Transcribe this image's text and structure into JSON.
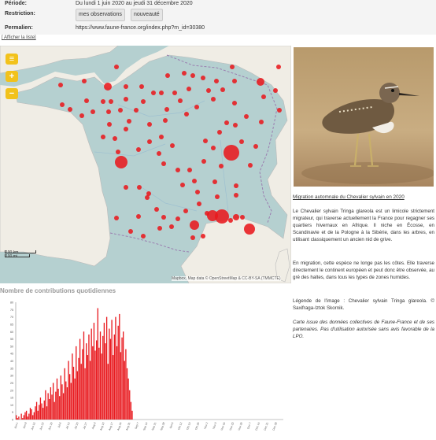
{
  "meta": {
    "period_label": "Période:",
    "period_value": "Du lundi 1 juin 2020 au jeudi 31 décembre 2020",
    "restriction_label": "Restriction:",
    "button_mine": "mes observations",
    "button_new": "nouveauté",
    "permalink_label": "Permalien:",
    "permalink_value": "https://www.faune-france.org/index.php?m_id=30380"
  },
  "list_toggle": "[ Afficher la liste]",
  "map": {
    "controls": [
      "layers-icon",
      "plus-icon",
      "minus-icon"
    ],
    "scale_km": "100 km",
    "scale_mi": "100 mi",
    "attribution": "Mapbox, Map data © OpenStreetMap & CC-BY-SA (TMMCTE)",
    "dot_color": "#e8191e"
  },
  "description": {
    "title": "Migration automnale du Chevalier sylvain en 2020",
    "para1": "Le Chevalier sylvain Tringa glareola est un limicole strictement migrateur, qui traverse actuellement la France pour regagner ses quartiers hivernaux en Afrique. Il niche en Écosse, en Scandinavie et de la Pologne à la Sibérie, dans les arbres, en utilisant classiquement un ancien nid de grive.",
    "para2": "En migration, cette espèce ne longe pas les côtes. Elle traverse directement le continent européen et peut donc être observée, au gré des haltes, dans tous les types de zones humides.",
    "legend": "Légende de l'image : Chevalier sylvain Tringa glareola. © Saxifraga-Iztok Skornik.",
    "note": "Carte issue des données collectives de Faune-France et de ses partenaires. Pas d'utilisation autorisée sans avis favorable de la LPO."
  },
  "chart_title": "Nombre de contributions quotidiennes",
  "chart_data": {
    "type": "bar",
    "color": "#e8191e",
    "ylim": [
      0,
      80
    ],
    "yticks": [
      0,
      5,
      10,
      15,
      20,
      25,
      30,
      35,
      40,
      45,
      50,
      55,
      60,
      65,
      70,
      75,
      80
    ],
    "values": [
      3,
      1,
      2,
      0,
      4,
      1,
      3,
      5,
      6,
      2,
      4,
      8,
      7,
      3,
      5,
      9,
      12,
      6,
      10,
      15,
      11,
      8,
      13,
      20,
      9,
      18,
      14,
      22,
      17,
      25,
      12,
      19,
      28,
      21,
      16,
      30,
      24,
      18,
      35,
      26,
      22,
      40,
      31,
      25,
      45,
      36,
      28,
      50,
      33,
      42,
      55,
      38,
      48,
      60,
      35,
      52,
      44,
      58,
      40,
      62,
      50,
      66,
      47,
      54,
      76,
      49,
      60,
      45,
      57,
      66,
      52,
      70,
      38,
      62,
      55,
      68,
      44,
      58,
      70,
      50,
      64,
      72,
      46,
      56,
      60,
      40,
      48,
      35,
      28,
      20,
      12,
      6,
      0,
      0,
      0,
      0,
      0,
      0,
      0,
      0,
      0,
      0,
      0,
      0,
      0,
      0,
      0,
      0,
      0,
      0,
      0,
      0,
      0,
      0,
      0,
      0,
      0,
      0,
      0,
      0,
      0,
      0,
      0,
      0,
      0,
      0,
      0,
      0,
      0,
      0,
      0,
      0,
      0,
      0,
      0,
      0,
      0,
      0,
      0,
      0,
      0,
      0,
      0,
      0,
      0,
      0,
      0,
      0,
      0,
      0,
      0,
      0,
      0,
      0,
      0,
      0,
      0,
      0,
      0,
      0,
      0,
      0,
      0,
      0,
      0,
      0,
      0,
      0,
      0,
      0,
      0,
      0,
      0,
      0,
      0,
      0,
      0,
      0,
      0,
      0,
      0,
      0,
      0,
      0,
      0,
      0,
      0,
      0,
      0,
      0,
      0,
      0,
      0,
      0,
      0,
      0,
      0,
      0,
      0,
      0,
      0,
      0,
      0,
      0,
      0,
      0,
      0,
      0,
      0,
      0
    ],
    "x_tick_labels": [
      "Jun 1",
      "Jun 8",
      "Jun 15",
      "Jun 22",
      "Jun 29",
      "Jul 6",
      "Jul 13",
      "Jul 20",
      "Jul 27",
      "Aug 3",
      "Aug 10",
      "Aug 17",
      "Aug 24",
      "Aug 31",
      "Sep 7",
      "Sep 14",
      "Sep 21",
      "Sep 28",
      "Oct 5",
      "Oct 12",
      "Oct 19",
      "Oct 26",
      "Nov 2",
      "Nov 9",
      "Nov 16",
      "Nov 23",
      "Nov 30",
      "Dec 7",
      "Dec 14",
      "Dec 21",
      "Dec 28"
    ]
  }
}
